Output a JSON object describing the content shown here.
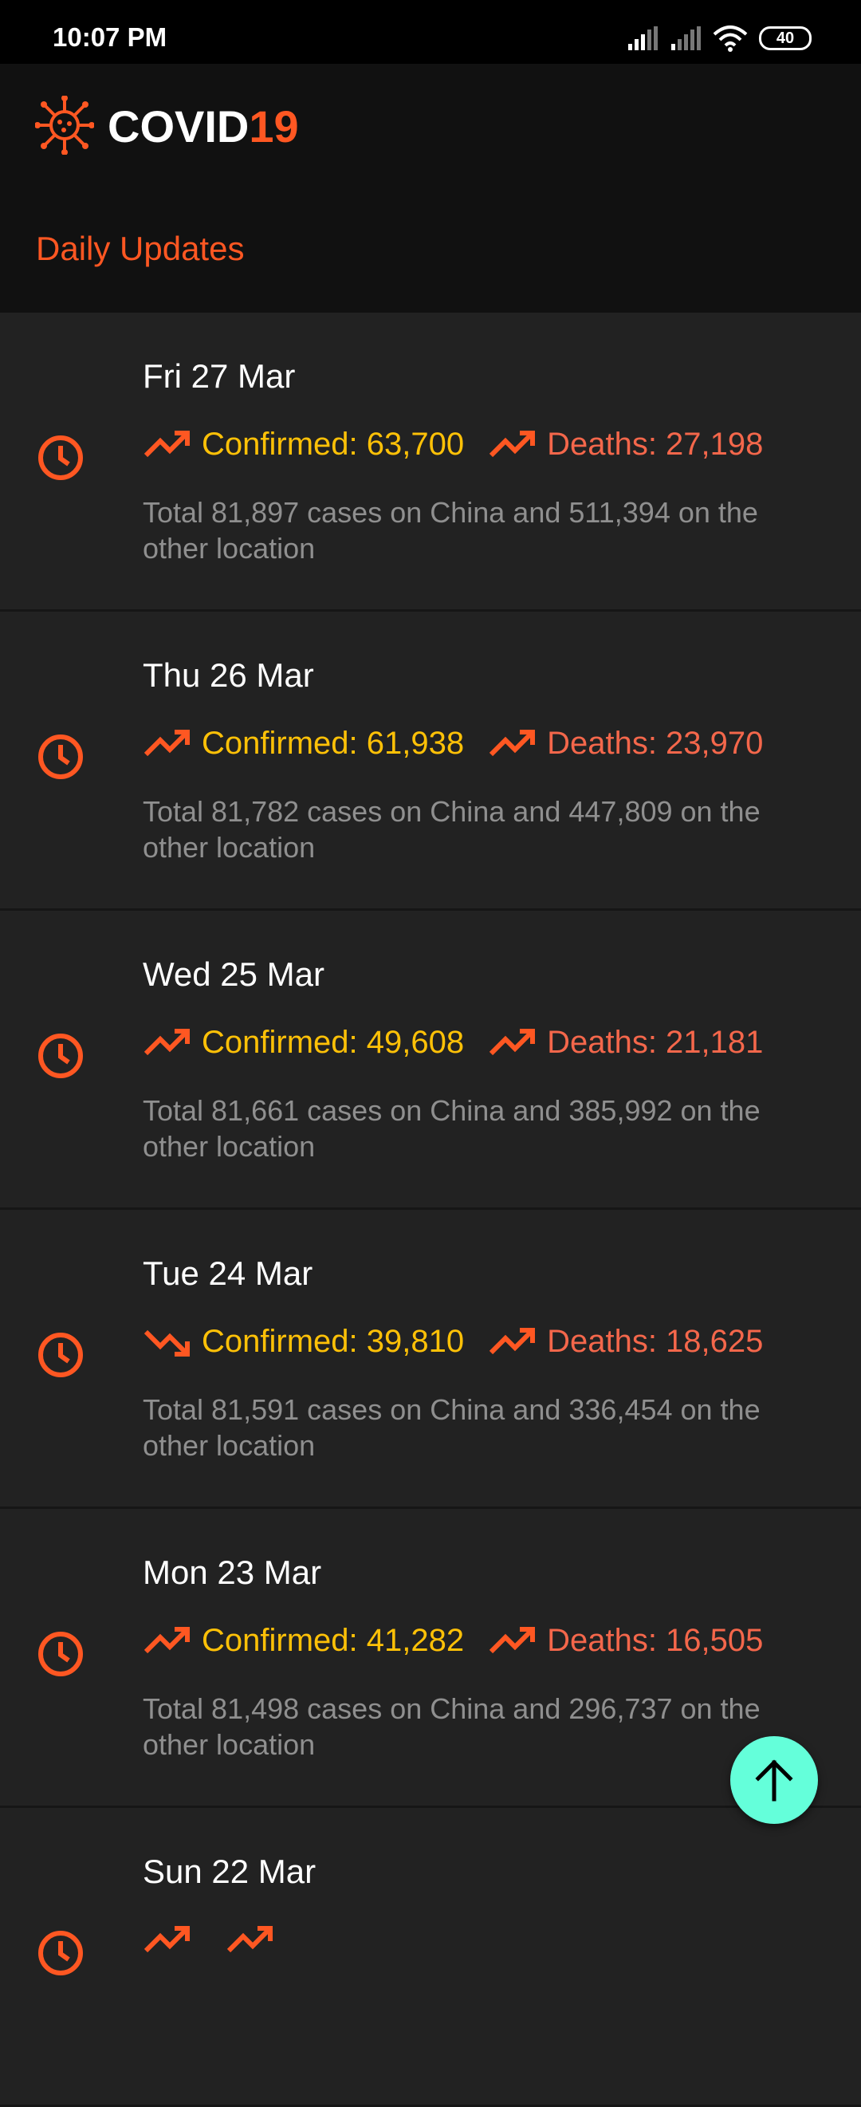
{
  "status_bar": {
    "time": "10:07 PM",
    "battery": "40"
  },
  "header": {
    "title_main": "COVID",
    "title_accent": "19",
    "section": "Daily Updates"
  },
  "colors": {
    "accent": "#ff5722",
    "confirmed": "#ffc107",
    "deaths": "#f4674b",
    "fab": "#64ffda"
  },
  "updates": [
    {
      "date": "Fri 27 Mar",
      "confirmed": "Confirmed: 63,700",
      "confirmed_trend": "up",
      "deaths": "Deaths: 27,198",
      "deaths_trend": "up",
      "total": "Total 81,897 cases on China and 511,394 on the other location"
    },
    {
      "date": "Thu 26 Mar",
      "confirmed": "Confirmed: 61,938",
      "confirmed_trend": "up",
      "deaths": "Deaths: 23,970",
      "deaths_trend": "up",
      "total": "Total 81,782 cases on China and 447,809 on the other location"
    },
    {
      "date": "Wed 25 Mar",
      "confirmed": "Confirmed: 49,608",
      "confirmed_trend": "up",
      "deaths": "Deaths: 21,181",
      "deaths_trend": "up",
      "total": "Total 81,661 cases on China and 385,992 on the other location"
    },
    {
      "date": "Tue 24 Mar",
      "confirmed": "Confirmed: 39,810",
      "confirmed_trend": "down",
      "deaths": "Deaths: 18,625",
      "deaths_trend": "up",
      "total": "Total 81,591 cases on China and 336,454 on the other location"
    },
    {
      "date": "Mon 23 Mar",
      "confirmed": "Confirmed: 41,282",
      "confirmed_trend": "up",
      "deaths": "Deaths: 16,505",
      "deaths_trend": "up",
      "total": "Total 81,498 cases on China and 296,737 on the other location"
    },
    {
      "date": "Sun 22 Mar",
      "confirmed": "",
      "confirmed_trend": "up",
      "deaths": "",
      "deaths_trend": "up",
      "total": ""
    }
  ]
}
